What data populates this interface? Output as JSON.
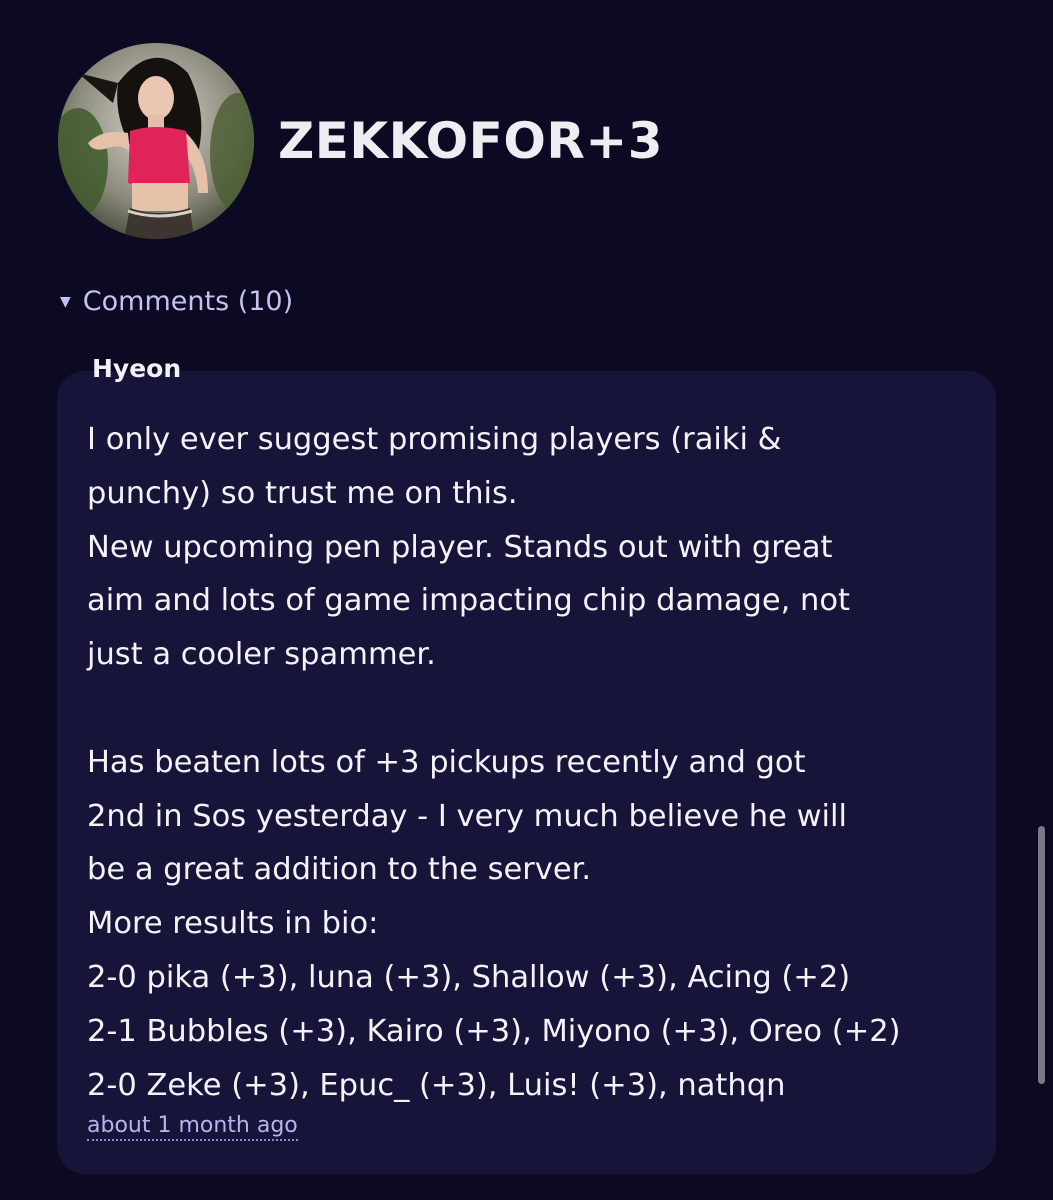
{
  "profile": {
    "username": "ZEKKOFOR+3"
  },
  "comments": {
    "toggle_label": "Comments (10)",
    "items": [
      {
        "author": "Hyeon",
        "body": "I only ever suggest promising players (raiki &\npunchy) so trust me on this.\nNew upcoming pen player. Stands out with great\naim and lots of game impacting chip damage, not\njust a cooler spammer.\n\nHas beaten lots of +3 pickups recently and got\n2nd in Sos yesterday - I very much believe he will\nbe a great addition to the server.\nMore results in bio:\n2-0 pika (+3), luna (+3), Shallow (+3), Acing (+2)\n2-1 Bubbles (+3), Kairo (+3), Miyono (+3), Oreo (+2)\n2-0 Zeke (+3), Epuc_ (+3), Luis! (+3), nathqn",
        "timestamp": "about 1 month ago"
      }
    ]
  },
  "icons": {
    "caret": "caret-down-icon"
  },
  "colors": {
    "background": "#0b0a22",
    "card": "#17143a",
    "accent": "#c4c2ee"
  }
}
